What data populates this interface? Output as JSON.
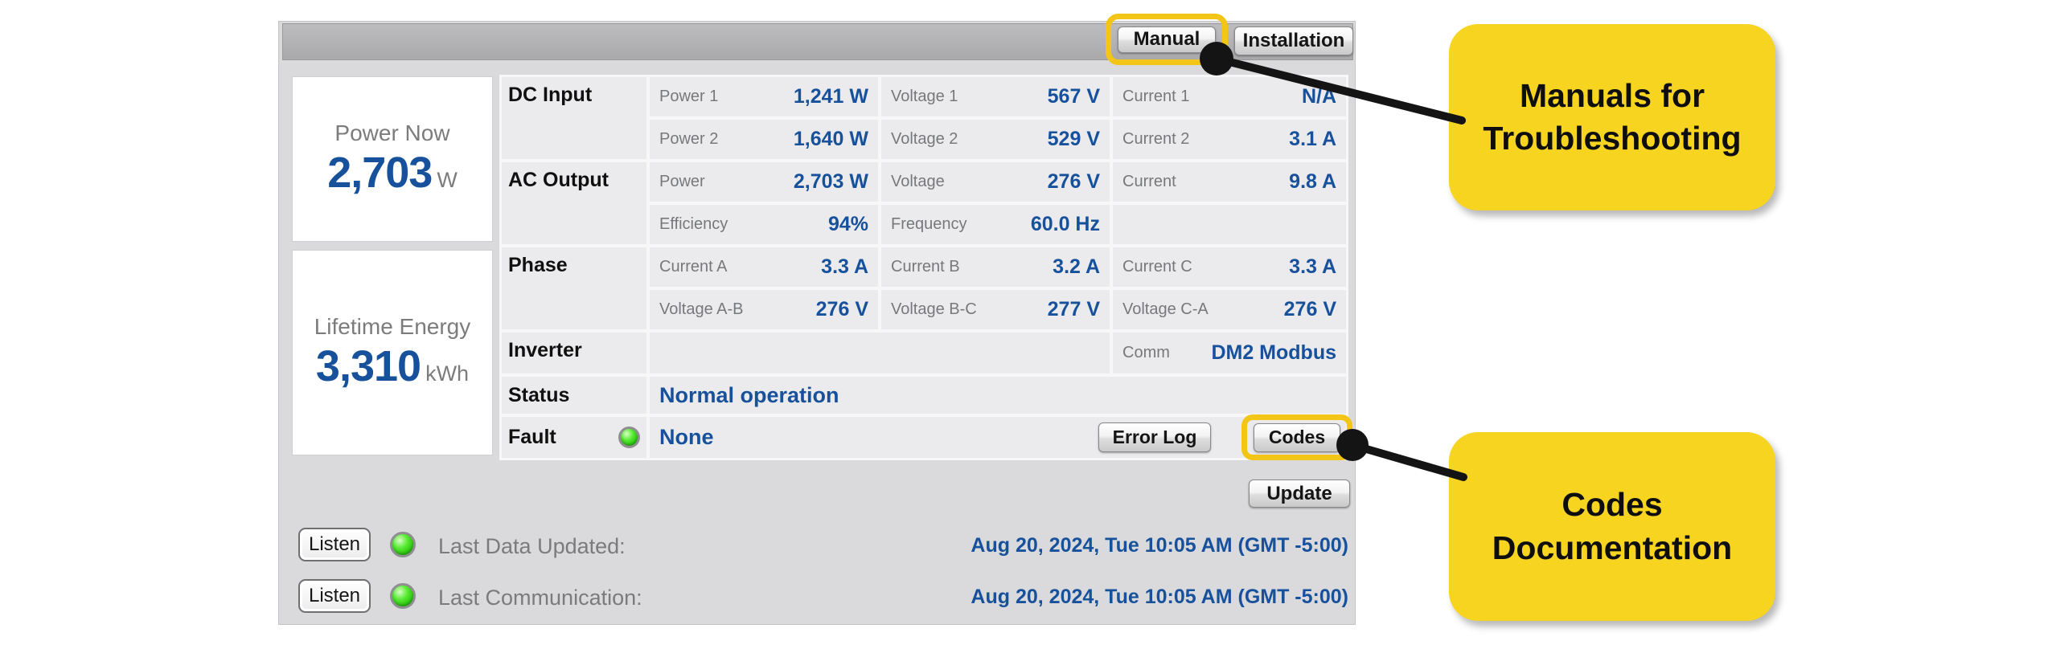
{
  "colors": {
    "value_blue": "#17519c",
    "callout_yellow": "#f6d420",
    "highlight_ring": "#f3c516",
    "led_green": "#2cc60f"
  },
  "toolbar": {
    "manual_label": "Manual",
    "installation_label": "Installation"
  },
  "summary": {
    "power_now": {
      "label": "Power Now",
      "value": "2,703",
      "unit": "W"
    },
    "lifetime_energy": {
      "label": "Lifetime Energy",
      "value": "3,310",
      "unit": "kWh"
    }
  },
  "table": {
    "sections": [
      {
        "header": "DC Input",
        "rows": [
          [
            {
              "label": "Power 1",
              "value": "1,241 W"
            },
            {
              "label": "Voltage 1",
              "value": "567 V"
            },
            {
              "label": "Current 1",
              "value": "N/A"
            }
          ],
          [
            {
              "label": "Power 2",
              "value": "1,640 W"
            },
            {
              "label": "Voltage 2",
              "value": "529 V"
            },
            {
              "label": "Current 2",
              "value": "3.1 A"
            }
          ]
        ]
      },
      {
        "header": "AC Output",
        "rows": [
          [
            {
              "label": "Power",
              "value": "2,703 W"
            },
            {
              "label": "Voltage",
              "value": "276 V"
            },
            {
              "label": "Current",
              "value": "9.8 A"
            }
          ],
          [
            {
              "label": "Efficiency",
              "value": "94%"
            },
            {
              "label": "Frequency",
              "value": "60.0 Hz"
            },
            null
          ]
        ]
      },
      {
        "header": "Phase",
        "rows": [
          [
            {
              "label": "Current A",
              "value": "3.3 A"
            },
            {
              "label": "Current B",
              "value": "3.2 A"
            },
            {
              "label": "Current C",
              "value": "3.3 A"
            }
          ],
          [
            {
              "label": "Voltage A-B",
              "value": "276 V"
            },
            {
              "label": "Voltage B-C",
              "value": "277 V"
            },
            {
              "label": "Voltage C-A",
              "value": "276 V"
            }
          ]
        ]
      }
    ],
    "inverter": {
      "header": "Inverter",
      "comm_label": "Comm",
      "comm_value": "DM2 Modbus"
    },
    "status": {
      "header": "Status",
      "value": "Normal operation"
    },
    "fault": {
      "header": "Fault",
      "value": "None",
      "error_log_label": "Error Log",
      "codes_label": "Codes"
    }
  },
  "update_label": "Update",
  "footer": {
    "rows": [
      {
        "listen_label": "Listen",
        "label": "Last Data Updated:",
        "value": "Aug 20, 2024, Tue 10:05 AM (GMT -5:00)"
      },
      {
        "listen_label": "Listen",
        "label": "Last Communication:",
        "value": "Aug 20, 2024, Tue 10:05 AM (GMT -5:00)"
      }
    ]
  },
  "callouts": {
    "manuals": {
      "line1": "Manuals for",
      "line2": "Troubleshooting"
    },
    "codes": {
      "line1": "Codes",
      "line2": "Documentation"
    }
  }
}
